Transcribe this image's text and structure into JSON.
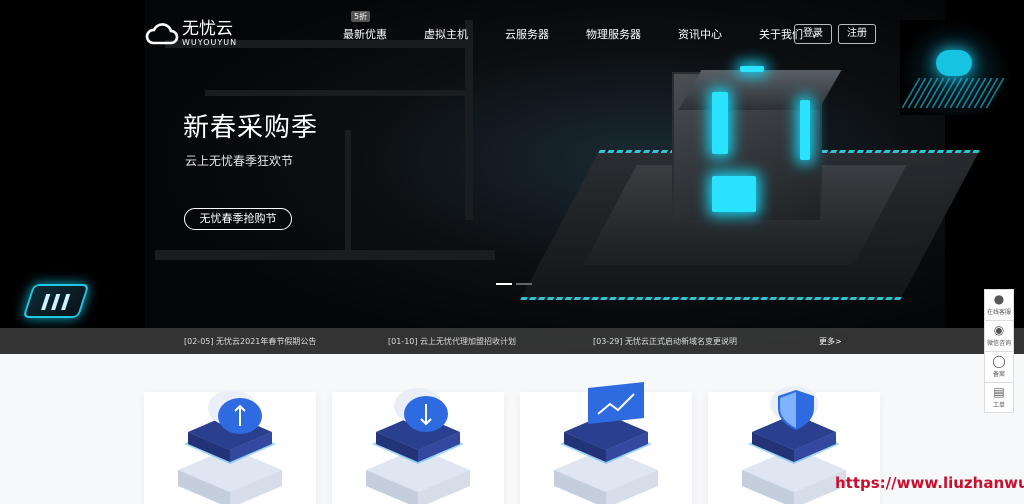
{
  "brand": {
    "name_cn": "无忧云",
    "name_en": "WUYOUYUN"
  },
  "nav": {
    "items": [
      {
        "label": "最新优惠",
        "badge": "5折"
      },
      {
        "label": "虚拟主机"
      },
      {
        "label": "云服务器"
      },
      {
        "label": "物理服务器"
      },
      {
        "label": "资讯中心"
      },
      {
        "label": "关于我们"
      }
    ],
    "login": "登录",
    "register": "注册"
  },
  "hero": {
    "title": "新春采购季",
    "subtitle": "云上无忧春季狂欢节",
    "button": "无忧春季抢购节"
  },
  "news": {
    "items": [
      "[02-05] 无忧云2021年春节假期公告",
      "[01-10] 云上无忧代理加盟招收计划",
      "[03-29] 无忧云正式启动新域名变更说明"
    ],
    "more": "更多>"
  },
  "side_tools": [
    {
      "icon": "qq-icon",
      "label": "在线客服"
    },
    {
      "icon": "wechat-icon",
      "label": "微信咨询"
    },
    {
      "icon": "shield-icon",
      "label": "备案"
    },
    {
      "icon": "ticket-icon",
      "label": "工单"
    }
  ],
  "cards": [
    {
      "icon": "cloud-server-upload-icon"
    },
    {
      "icon": "cloud-server-download-icon"
    },
    {
      "icon": "chart-server-icon"
    },
    {
      "icon": "shield-server-icon"
    }
  ],
  "watermark": "https://www.liuzhanwu.cn",
  "colors": {
    "accent": "#28e2ff",
    "card_blue": "#2f5bd8",
    "watermark": "#c8102e"
  }
}
